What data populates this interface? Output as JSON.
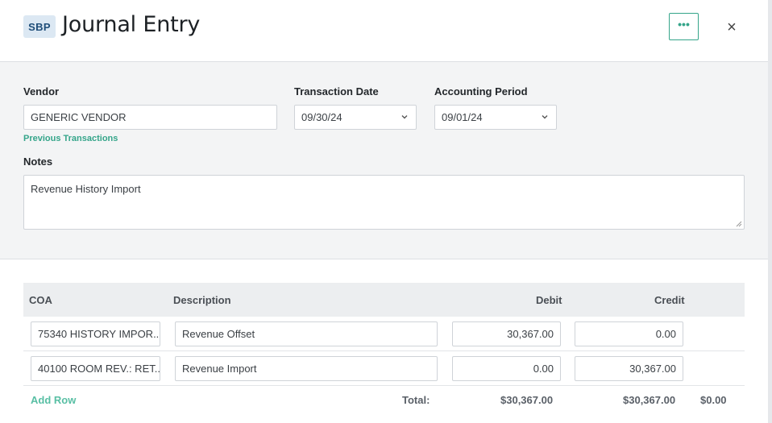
{
  "header": {
    "badge": "SBP",
    "title": "Journal Entry",
    "more_label": "•••",
    "close_label": "×"
  },
  "form": {
    "vendor_label": "Vendor",
    "vendor_value": "GENERIC VENDOR",
    "previous_transactions": "Previous Transactions",
    "transaction_date_label": "Transaction Date",
    "transaction_date_value": "09/30/24",
    "accounting_period_label": "Accounting Period",
    "accounting_period_value": "09/01/24",
    "notes_label": "Notes",
    "notes_value": "Revenue History Import"
  },
  "table": {
    "columns": {
      "coa": "COA",
      "description": "Description",
      "debit": "Debit",
      "credit": "Credit"
    },
    "rows": [
      {
        "coa": "75340 HISTORY IMPOR...",
        "description": "Revenue Offset",
        "debit": "30,367.00",
        "credit": "0.00"
      },
      {
        "coa": "40100 ROOM REV.: RET...",
        "description": "Revenue Import",
        "debit": "0.00",
        "credit": "30,367.00"
      }
    ],
    "add_row": "Add Row",
    "total_label": "Total:",
    "total_debit": "$30,367.00",
    "total_credit": "$30,367.00",
    "difference": "$0.00"
  },
  "colors": {
    "accent": "#35a58a",
    "badge_bg": "#dce8f3",
    "panel_bg": "#f3f4f5"
  }
}
